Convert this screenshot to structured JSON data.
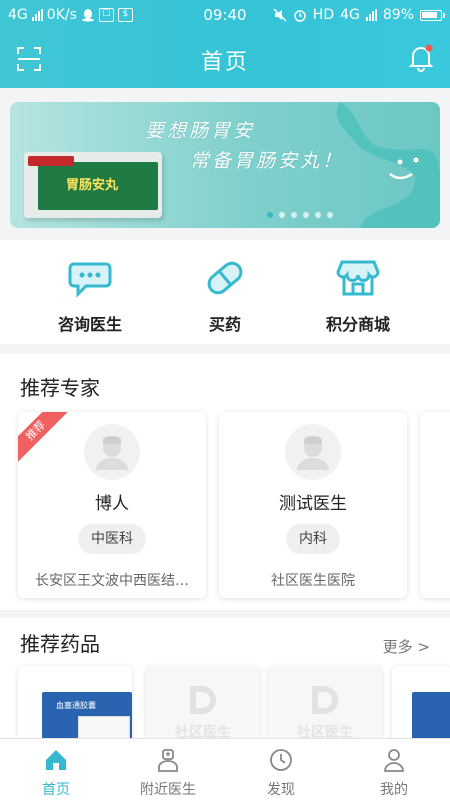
{
  "status_bar": {
    "network": "4G",
    "speed": "0K/s",
    "time": "09:40",
    "hd": "HD",
    "hd_net": "4G",
    "battery": "89%"
  },
  "header": {
    "title": "首页"
  },
  "banner": {
    "line1": "要想肠胃安",
    "line2": "常备胃肠安丸！",
    "product_label": "胃肠安丸",
    "slide_count": 6,
    "active_slide": 0
  },
  "actions": [
    {
      "label": "咨询医生",
      "icon": "chat-icon"
    },
    {
      "label": "买药",
      "icon": "pill-icon"
    },
    {
      "label": "积分商城",
      "icon": "shop-icon"
    }
  ],
  "doctors_section": {
    "title": "推荐专家",
    "ribbon": "推荐",
    "items": [
      {
        "name": "博人",
        "dept": "中医科",
        "hospital": "长安区王文波中西医结…"
      },
      {
        "name": "测试医生",
        "dept": "内科",
        "hospital": "社区医生医院"
      }
    ]
  },
  "drugs_section": {
    "title": "推荐药品",
    "more": "更多 >",
    "placeholder_text": "社区医生",
    "pack_label": "血塞通胶囊"
  },
  "tabbar": [
    {
      "label": "首页",
      "icon": "home-icon",
      "active": true
    },
    {
      "label": "附近医生",
      "icon": "doctor-icon",
      "active": false
    },
    {
      "label": "发现",
      "icon": "discover-icon",
      "active": false
    },
    {
      "label": "我的",
      "icon": "profile-icon",
      "active": false
    }
  ],
  "colors": {
    "accent": "#34b9ce",
    "ribbon": "#f06060"
  }
}
